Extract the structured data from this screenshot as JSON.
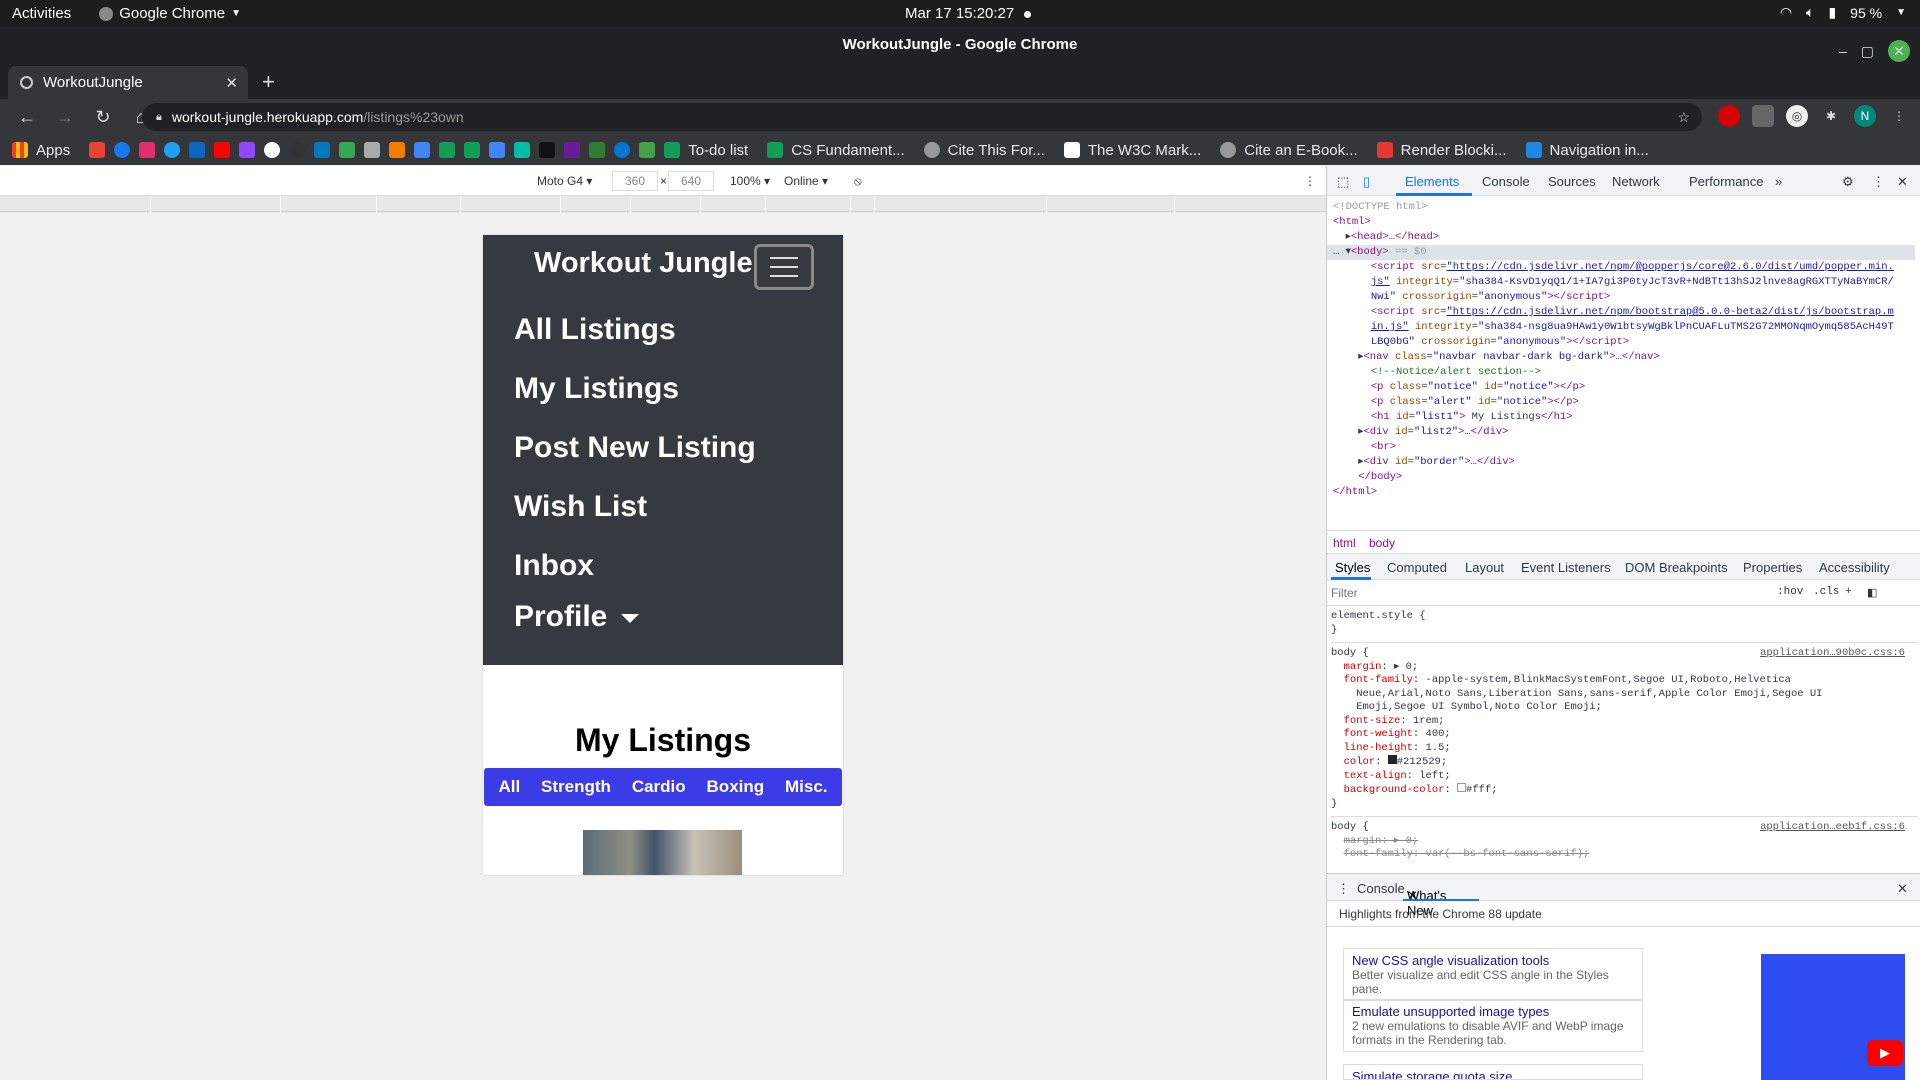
{
  "os_bar": {
    "activities": "Activities",
    "app": "Google Chrome",
    "clock": "Mar 17  15:20:27",
    "battery": "95 %"
  },
  "window": {
    "title": "WorkoutJungle - Google Chrome"
  },
  "tab": {
    "title": "WorkoutJungle"
  },
  "omnibox": {
    "host": "workout-jungle.herokuapp.com",
    "path": "/listings%23own"
  },
  "profile_initial": "N",
  "bookmarks": {
    "apps": "Apps",
    "items": [
      "To-do list",
      "CS Fundament...",
      "Cite This For...",
      "The W3C Mark...",
      "Cite an E-Book...",
      "Render Blocki...",
      "Navigation in..."
    ]
  },
  "device_toolbar": {
    "device": "Moto G4",
    "width": "360",
    "height": "640",
    "zoom": "100%",
    "network": "Online"
  },
  "site": {
    "brand": "Workout Jungle",
    "nav": {
      "all_listings": "All Listings",
      "my_listings": "My Listings",
      "post_new": "Post New Listing",
      "wish_list": "Wish List",
      "inbox": "Inbox",
      "profile": "Profile"
    },
    "heading": "My Listings",
    "filters": [
      "All",
      "Strength",
      "Cardio",
      "Boxing",
      "Misc."
    ]
  },
  "devtools": {
    "tabs": [
      "Elements",
      "Console",
      "Sources",
      "Network",
      "Performance"
    ],
    "breadcrumbs": [
      "html",
      "body"
    ],
    "style_tabs": [
      "Styles",
      "Computed",
      "Layout",
      "Event Listeners",
      "DOM Breakpoints",
      "Properties",
      "Accessibility"
    ],
    "filter_placeholder": "Filter",
    "hov": ":hov",
    "cls": ".cls",
    "style_source_1": "application…90b0c.css:6",
    "style_source_2": "application…eeb1f.css:6",
    "drawer_tabs": [
      "Console",
      "What's New"
    ],
    "highlights": "Highlights from the Chrome 88 update",
    "whats_new": [
      {
        "title": "New CSS angle visualization tools",
        "desc": "Better visualize and edit CSS angle in the Styles pane."
      },
      {
        "title": "Emulate unsupported image types",
        "desc": "2 new emulations to disable AVIF and WebP image formats in the Rendering tab."
      },
      {
        "title": "Simulate storage quota size",
        "desc": ""
      }
    ]
  },
  "colors": {
    "navbar_bg": "#343a40",
    "filter_bar_bg": "#3b3be8",
    "chrome_dark": "#202124",
    "devtools_accent": "#1a73e8"
  }
}
